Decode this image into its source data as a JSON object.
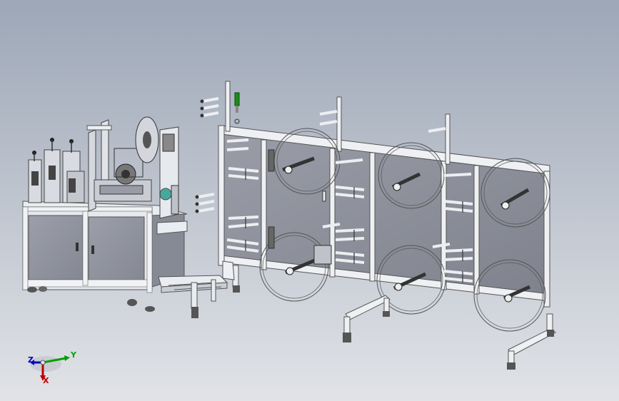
{
  "viewport": {
    "background_top": "#9da7b7",
    "background_bottom": "#e1e3e7"
  },
  "model": {
    "frame_color": "#e6e9ee",
    "panel_color": "#8e919b",
    "reel_stroke": "#555555",
    "beacon_color": "#1c8c1c"
  },
  "triad": {
    "x_label": "X",
    "y_label": "Y",
    "z_label": "Z",
    "x_color": "#c00000",
    "y_color": "#00a000",
    "z_color": "#0000c0"
  }
}
